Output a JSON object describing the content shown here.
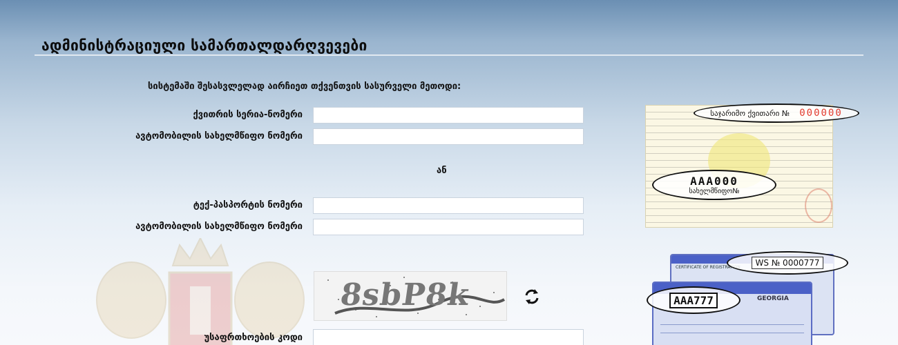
{
  "header": {
    "title": "ადმინისტრაციული სამართალდარღვევები"
  },
  "form": {
    "instruction": "სისტემაში შესასვლელად აირჩიეთ თქვენთვის სასურველი მეთოდი:",
    "method1": {
      "receipt_label": "ქვითრის სერია-ნომერი",
      "receipt_value": "",
      "plate_label": "ავტომობილის სახელმწიფო ნომერი",
      "plate_value": ""
    },
    "or_label": "ან",
    "method2": {
      "passport_label": "ტექ-პასპორტის ნომერი",
      "passport_value": "",
      "plate_label": "ავტომობილის სახელმწიფო ნომერი",
      "plate_value": ""
    },
    "captcha_text": "8sbP8k",
    "security_code_label": "უსაფრთხოების კოდი",
    "security_code_value": ""
  },
  "samples": {
    "receipt": {
      "serial_label": "საჯარიმო ქვითარი №",
      "serial_number": "000000",
      "plate": "AAA000",
      "plate_caption": "სახელმწიფო№"
    },
    "tech_passport": {
      "number": "WS № 0000777",
      "plate": "AAA777",
      "card_header": "CERTIFICATE OF REGISTRATION",
      "card_country": "GEORGIA"
    }
  },
  "colors": {
    "accent_red": "#e23a2e",
    "card_blue": "#4b61c7"
  },
  "icons": {
    "refresh": "refresh-icon",
    "coat_of_arms": "coat-of-arms-icon"
  }
}
